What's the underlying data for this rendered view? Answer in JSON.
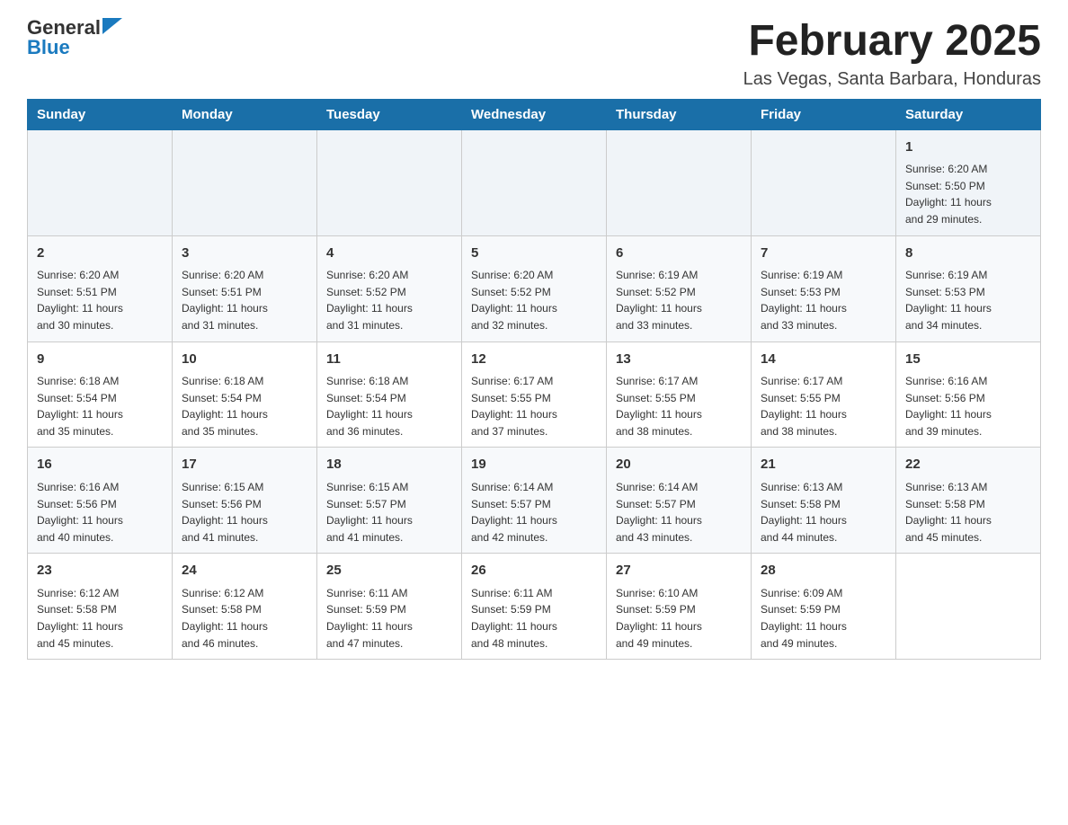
{
  "header": {
    "logo_general": "General",
    "logo_blue": "Blue",
    "month_title": "February 2025",
    "location": "Las Vegas, Santa Barbara, Honduras"
  },
  "weekdays": [
    "Sunday",
    "Monday",
    "Tuesday",
    "Wednesday",
    "Thursday",
    "Friday",
    "Saturday"
  ],
  "weeks": [
    [
      {
        "day": "",
        "info": ""
      },
      {
        "day": "",
        "info": ""
      },
      {
        "day": "",
        "info": ""
      },
      {
        "day": "",
        "info": ""
      },
      {
        "day": "",
        "info": ""
      },
      {
        "day": "",
        "info": ""
      },
      {
        "day": "1",
        "info": "Sunrise: 6:20 AM\nSunset: 5:50 PM\nDaylight: 11 hours\nand 29 minutes."
      }
    ],
    [
      {
        "day": "2",
        "info": "Sunrise: 6:20 AM\nSunset: 5:51 PM\nDaylight: 11 hours\nand 30 minutes."
      },
      {
        "day": "3",
        "info": "Sunrise: 6:20 AM\nSunset: 5:51 PM\nDaylight: 11 hours\nand 31 minutes."
      },
      {
        "day": "4",
        "info": "Sunrise: 6:20 AM\nSunset: 5:52 PM\nDaylight: 11 hours\nand 31 minutes."
      },
      {
        "day": "5",
        "info": "Sunrise: 6:20 AM\nSunset: 5:52 PM\nDaylight: 11 hours\nand 32 minutes."
      },
      {
        "day": "6",
        "info": "Sunrise: 6:19 AM\nSunset: 5:52 PM\nDaylight: 11 hours\nand 33 minutes."
      },
      {
        "day": "7",
        "info": "Sunrise: 6:19 AM\nSunset: 5:53 PM\nDaylight: 11 hours\nand 33 minutes."
      },
      {
        "day": "8",
        "info": "Sunrise: 6:19 AM\nSunset: 5:53 PM\nDaylight: 11 hours\nand 34 minutes."
      }
    ],
    [
      {
        "day": "9",
        "info": "Sunrise: 6:18 AM\nSunset: 5:54 PM\nDaylight: 11 hours\nand 35 minutes."
      },
      {
        "day": "10",
        "info": "Sunrise: 6:18 AM\nSunset: 5:54 PM\nDaylight: 11 hours\nand 35 minutes."
      },
      {
        "day": "11",
        "info": "Sunrise: 6:18 AM\nSunset: 5:54 PM\nDaylight: 11 hours\nand 36 minutes."
      },
      {
        "day": "12",
        "info": "Sunrise: 6:17 AM\nSunset: 5:55 PM\nDaylight: 11 hours\nand 37 minutes."
      },
      {
        "day": "13",
        "info": "Sunrise: 6:17 AM\nSunset: 5:55 PM\nDaylight: 11 hours\nand 38 minutes."
      },
      {
        "day": "14",
        "info": "Sunrise: 6:17 AM\nSunset: 5:55 PM\nDaylight: 11 hours\nand 38 minutes."
      },
      {
        "day": "15",
        "info": "Sunrise: 6:16 AM\nSunset: 5:56 PM\nDaylight: 11 hours\nand 39 minutes."
      }
    ],
    [
      {
        "day": "16",
        "info": "Sunrise: 6:16 AM\nSunset: 5:56 PM\nDaylight: 11 hours\nand 40 minutes."
      },
      {
        "day": "17",
        "info": "Sunrise: 6:15 AM\nSunset: 5:56 PM\nDaylight: 11 hours\nand 41 minutes."
      },
      {
        "day": "18",
        "info": "Sunrise: 6:15 AM\nSunset: 5:57 PM\nDaylight: 11 hours\nand 41 minutes."
      },
      {
        "day": "19",
        "info": "Sunrise: 6:14 AM\nSunset: 5:57 PM\nDaylight: 11 hours\nand 42 minutes."
      },
      {
        "day": "20",
        "info": "Sunrise: 6:14 AM\nSunset: 5:57 PM\nDaylight: 11 hours\nand 43 minutes."
      },
      {
        "day": "21",
        "info": "Sunrise: 6:13 AM\nSunset: 5:58 PM\nDaylight: 11 hours\nand 44 minutes."
      },
      {
        "day": "22",
        "info": "Sunrise: 6:13 AM\nSunset: 5:58 PM\nDaylight: 11 hours\nand 45 minutes."
      }
    ],
    [
      {
        "day": "23",
        "info": "Sunrise: 6:12 AM\nSunset: 5:58 PM\nDaylight: 11 hours\nand 45 minutes."
      },
      {
        "day": "24",
        "info": "Sunrise: 6:12 AM\nSunset: 5:58 PM\nDaylight: 11 hours\nand 46 minutes."
      },
      {
        "day": "25",
        "info": "Sunrise: 6:11 AM\nSunset: 5:59 PM\nDaylight: 11 hours\nand 47 minutes."
      },
      {
        "day": "26",
        "info": "Sunrise: 6:11 AM\nSunset: 5:59 PM\nDaylight: 11 hours\nand 48 minutes."
      },
      {
        "day": "27",
        "info": "Sunrise: 6:10 AM\nSunset: 5:59 PM\nDaylight: 11 hours\nand 49 minutes."
      },
      {
        "day": "28",
        "info": "Sunrise: 6:09 AM\nSunset: 5:59 PM\nDaylight: 11 hours\nand 49 minutes."
      },
      {
        "day": "",
        "info": ""
      }
    ]
  ]
}
